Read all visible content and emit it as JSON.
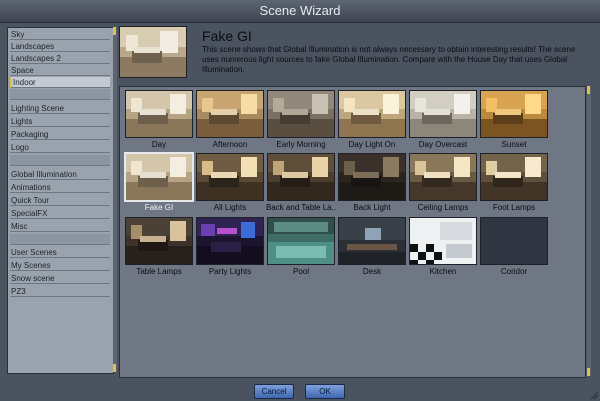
{
  "window": {
    "title": "Scene Wizard"
  },
  "sidebar": {
    "items": [
      {
        "label": "Sky"
      },
      {
        "label": "Landscapes"
      },
      {
        "label": "Landscapes 2"
      },
      {
        "label": "Space"
      },
      {
        "label": "Indoor",
        "selected": true
      },
      {
        "label": "Lighting Scene"
      },
      {
        "label": "Lights"
      },
      {
        "label": "Packaging"
      },
      {
        "label": "Logo"
      },
      {
        "label": "Global Illumination"
      },
      {
        "label": "Animations"
      },
      {
        "label": "Quick Tour"
      },
      {
        "label": "SpecialFX"
      },
      {
        "label": "Misc"
      },
      {
        "label": "User Scenes"
      },
      {
        "label": "My Scenes"
      },
      {
        "label": "Snow scene"
      },
      {
        "label": "PZ3"
      }
    ]
  },
  "preview": {
    "title": "Fake GI",
    "description": "This scene shows that Global Illumination is not always necessary to obtain interesting results! The scene uses numerous light sources to fake Global Illumination. Compare with the House Day that uses Global Illumination."
  },
  "scenes": [
    {
      "label": "Day",
      "palette": "warm"
    },
    {
      "label": "Afternoon",
      "palette": "amber"
    },
    {
      "label": "Early Morning",
      "palette": "dim"
    },
    {
      "label": "Day Light On",
      "palette": "warm"
    },
    {
      "label": "Day Overcast",
      "palette": "pale"
    },
    {
      "label": "Sunset",
      "palette": "gold"
    },
    {
      "label": "Fake GI",
      "palette": "warm",
      "selected": true
    },
    {
      "label": "All Lights",
      "palette": "night-warm"
    },
    {
      "label": "Back and Table La..",
      "palette": "night-warm"
    },
    {
      "label": "Back Light",
      "palette": "night-dark"
    },
    {
      "label": "Ceiling Lamps",
      "palette": "night-warm"
    },
    {
      "label": "Foot Lamps",
      "palette": "night-warm"
    },
    {
      "label": "Table Lamps",
      "palette": "night-dark"
    },
    {
      "label": "Party Lights",
      "palette": "party"
    },
    {
      "label": "Pool",
      "palette": "pool"
    },
    {
      "label": "Desk",
      "palette": "desk"
    },
    {
      "label": "Kitchen",
      "palette": "kitchen"
    },
    {
      "label": "Coridor",
      "palette": "empty"
    }
  ],
  "buttons": {
    "cancel": "Cancel",
    "ok": "OK"
  },
  "colors": {
    "accent": "#d8c44a",
    "button": "#5b83c8",
    "list_bg": "#9aa3ad",
    "grid_bg": "#6f7784"
  }
}
